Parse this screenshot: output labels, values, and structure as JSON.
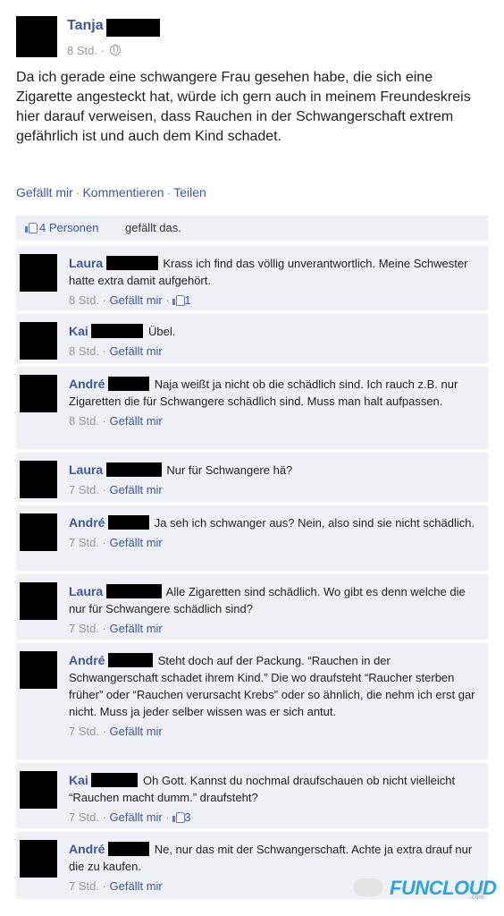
{
  "post": {
    "author": "Tanja",
    "time": "8 Std.",
    "text": "Da ich gerade eine schwangere Frau gesehen habe, die sich eine Zigarette angesteckt hat, würde ich gern auch in meinem Freundeskreis hier darauf verweisen, dass Rauchen in der Schwangerschaft extrem gefährlich ist und auch dem Kind schadet.",
    "actions": {
      "like": "Gefällt mir",
      "comment": "Kommentieren",
      "share": "Teilen"
    }
  },
  "likes": {
    "count_text": "4 Personen",
    "rest_text": "gefällt das."
  },
  "comments": [
    {
      "name": "Laura",
      "text": "Krass ich find das völlig unverantwortlich. Meine Schwester hatte extra damit aufgehört.",
      "time": "8 Std.",
      "like": "Gefällt mir",
      "like_count": "1"
    },
    {
      "name": "Kai",
      "text": "Übel.",
      "time": "8 Std.",
      "like": "Gefällt mir",
      "like_count": ""
    },
    {
      "name": "André",
      "text": "Naja weißt ja nicht ob die schädlich sind. Ich rauch z.B. nur Zigaretten die für Schwangere schädlich sind. Muss man halt aufpassen.",
      "time": "8 Std.",
      "like": "Gefällt mir",
      "like_count": ""
    },
    {
      "name": "Laura",
      "text": "Nur für Schwangere hä?",
      "time": "7 Std.",
      "like": "Gefällt mir",
      "like_count": ""
    },
    {
      "name": "André",
      "text": "Ja seh ich schwanger aus? Nein, also sind sie nicht schädlich.",
      "time": "7 Std.",
      "like": "Gefällt mir",
      "like_count": ""
    },
    {
      "name": "Laura",
      "text": "Alle Zigaretten sind schädlich. Wo gibt es denn welche die nur für Schwangere schädlich sind?",
      "time": "7 Std.",
      "like": "Gefällt mir",
      "like_count": ""
    },
    {
      "name": "André",
      "text": "Steht doch auf der Packung. “Rauchen in der Schwangerschaft schadet ihrem Kind.” Die wo draufsteht “Raucher sterben früher” oder “Rauchen verursacht Krebs” oder so ähnlich, die nehm ich erst gar nicht. Muss ja jeder selber wissen was er sich antut.",
      "time": "7 Std.",
      "like": "Gefällt mir",
      "like_count": ""
    },
    {
      "name": "Kai",
      "text": "Oh Gott. Kannst du nochmal draufschauen ob nicht vielleicht “Rauchen macht dumm.” draufsteht?",
      "time": "7 Std.",
      "like": "Gefällt mir",
      "like_count": "3"
    },
    {
      "name": "André",
      "text": "Ne, nur das mit der Schwangerschaft. Achte ja extra drauf nur die zu kaufen.",
      "time": "7 Std.",
      "like": "Gefällt mir",
      "like_count": ""
    }
  ],
  "watermark": {
    "brand": "FUNCLOUD",
    "sub": ".com"
  },
  "colors": {
    "link": "#3b5998",
    "meta": "#9197a3",
    "comment_bg": "#eef0f5",
    "watermark": "#2ba3dc"
  }
}
